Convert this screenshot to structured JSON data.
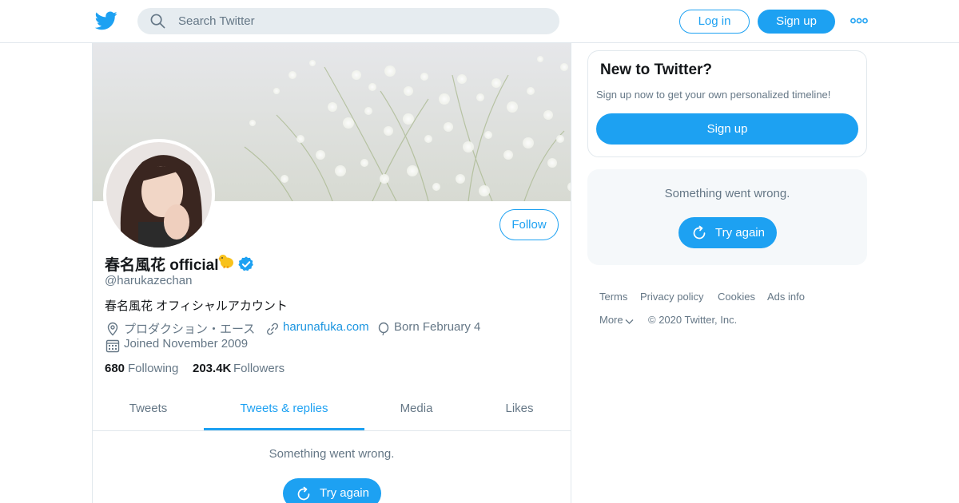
{
  "topbar": {
    "search_placeholder": "Search Twitter",
    "login_label": "Log in",
    "signup_label": "Sign up"
  },
  "profile": {
    "display_name": "春名風花 official",
    "handle": "@harukazechan",
    "bio": "春名風花 オフィシャルアカウント",
    "location": "プロダクション・エース",
    "website": "harunafuka.com",
    "birthday": "Born February 4",
    "joined": "Joined November 2009",
    "following_count": "680",
    "following_label": "Following",
    "followers_count": "203.4K",
    "followers_label": "Followers",
    "follow_label": "Follow"
  },
  "tabs": [
    {
      "label": "Tweets",
      "active": false
    },
    {
      "label": "Tweets & replies",
      "active": true
    },
    {
      "label": "Media",
      "active": false
    },
    {
      "label": "Likes",
      "active": false
    }
  ],
  "timeline": {
    "error_text": "Something went wrong.",
    "retry_label": "Try again"
  },
  "sidebar": {
    "new_title": "New to Twitter?",
    "new_subtitle": "Sign up now to get your own personalized timeline!",
    "signup_label": "Sign up",
    "error_text": "Something went wrong.",
    "retry_label": "Try again"
  },
  "footer": {
    "links": [
      "Terms",
      "Privacy policy",
      "Cookies",
      "Ads info",
      "More"
    ],
    "copyright": "© 2020 Twitter, Inc."
  },
  "colors": {
    "accent": "#1da1f2",
    "secondary_text": "#657786",
    "border": "#e1e8ed",
    "card_bg": "#f5f8fa"
  },
  "icons": [
    "twitter-bird-icon",
    "search-icon",
    "more-dots-icon",
    "chick-emoji-icon",
    "verified-badge-icon",
    "location-icon",
    "link-icon",
    "balloon-icon",
    "calendar-icon",
    "refresh-icon",
    "chevron-down-icon"
  ]
}
